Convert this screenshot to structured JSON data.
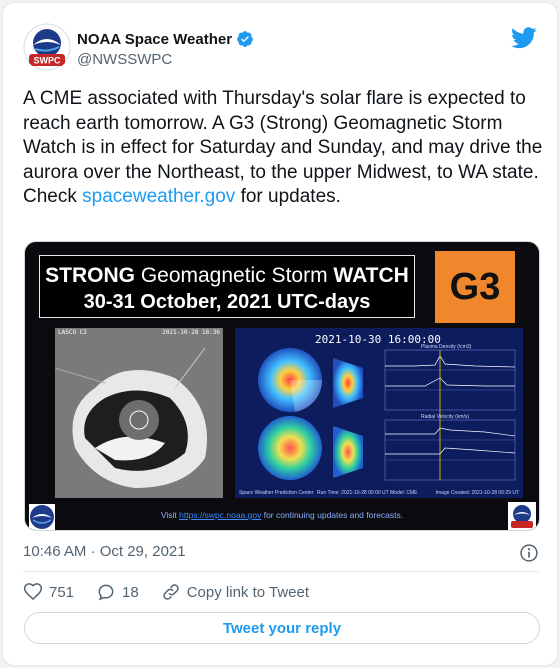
{
  "account": {
    "name": "NOAA Space Weather",
    "handle": "@NWSSWPC",
    "avatar_text": "SWPC"
  },
  "tweet": {
    "text_before_link": "A CME associated with Thursday's solar flare is expected to reach earth tomorrow. A G3 (Strong) Geomagnetic Storm Watch is in effect for Saturday and Sunday, and may drive the aurora over the Northeast, to the upper Midwest, to WA state. Check ",
    "link_text": "spaceweather.gov",
    "text_after_link": " for updates.",
    "timestamp": "10:46 AM · Oct 29, 2021"
  },
  "media": {
    "banner_strong": "STRONG",
    "banner_mid": " Geomagnetic Storm ",
    "banner_watch": "WATCH",
    "banner_line2": "30-31 October, 2021 UTC-days",
    "g3_label": "G3",
    "lasco_label": "LASCO C2",
    "lasco_date": "2021-10-28 18:36",
    "enlil_time": "2021-10-30  16:00:00",
    "enlil_footer": "Space Weather Prediction Center",
    "enlil_run": "Run Time: 2021-10-28 00:00 UT   Model: CME",
    "enlil_img": "Image Created: 2021-10-28 06:29 UT",
    "plasma_density_title": "Plasma Density (/cm3)",
    "radial_velocity_title": "Radial Velocity (km/s)",
    "visit_prefix": "Visit ",
    "visit_link": "https://swpc.noaa.gov",
    "visit_suffix": " for continuing updates and forecasts."
  },
  "actions": {
    "likes": "751",
    "replies": "18",
    "copy_link": "Copy link to Tweet"
  },
  "reply_button": "Tweet your reply",
  "colors": {
    "accent": "#1d9bf0",
    "g3_orange": "#f0872c",
    "text_secondary": "#536471"
  },
  "icons": [
    "verified-badge-icon",
    "twitter-bird-icon",
    "info-icon",
    "heart-icon",
    "reply-bubble-icon",
    "link-icon"
  ]
}
